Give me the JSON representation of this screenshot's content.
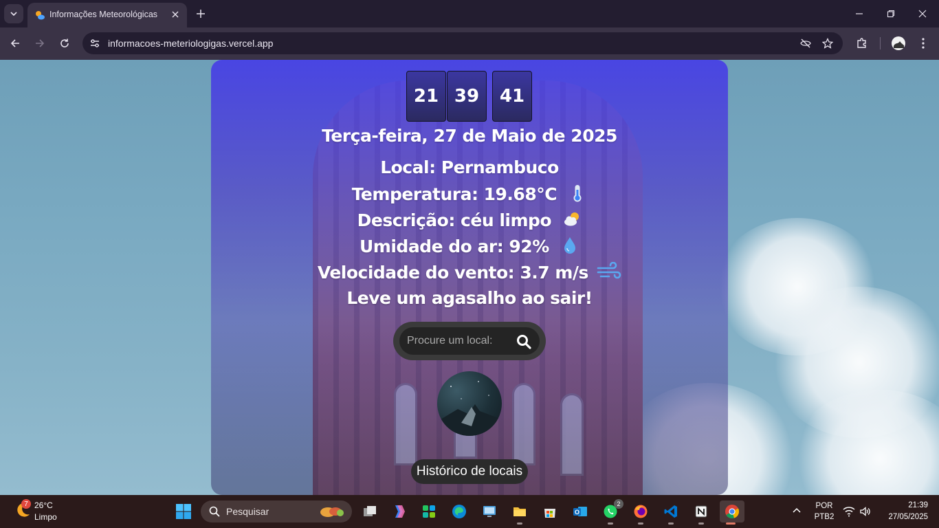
{
  "browser": {
    "tab_title": "Informações Meteorológicas",
    "url": "informacoes-meteriologigas.vercel.app"
  },
  "clock": {
    "hours": "21",
    "minutes": "39",
    "seconds": "41"
  },
  "weather": {
    "date": "Terça-feira, 27 de Maio de 2025",
    "location": "Local: Pernambuco",
    "temperature": "Temperatura: 19.68°C",
    "description": "Descrição: céu limpo",
    "humidity": "Umidade do ar: 92%",
    "wind": "Velocidade do vento: 3.7 m/s",
    "advice": "Leve um agasalho ao sair!",
    "icons": [
      "thermometer-icon",
      "sun-behind-cloud-icon",
      "droplet-icon",
      "wind-icon"
    ]
  },
  "search": {
    "placeholder": "Procure um local:"
  },
  "history": {
    "label": "Histórico de locais"
  },
  "taskbar": {
    "weather_badge": "7",
    "weather_temp": "26°C",
    "weather_desc": "Limpo",
    "search_label": "Pesquisar",
    "whatsapp_badge": "2",
    "language_line1": "POR",
    "language_line2": "PTB2",
    "time": "21:39",
    "date": "27/05/2025"
  },
  "colors": {
    "card_top": "#463ee6",
    "accent": "#e07a66"
  }
}
